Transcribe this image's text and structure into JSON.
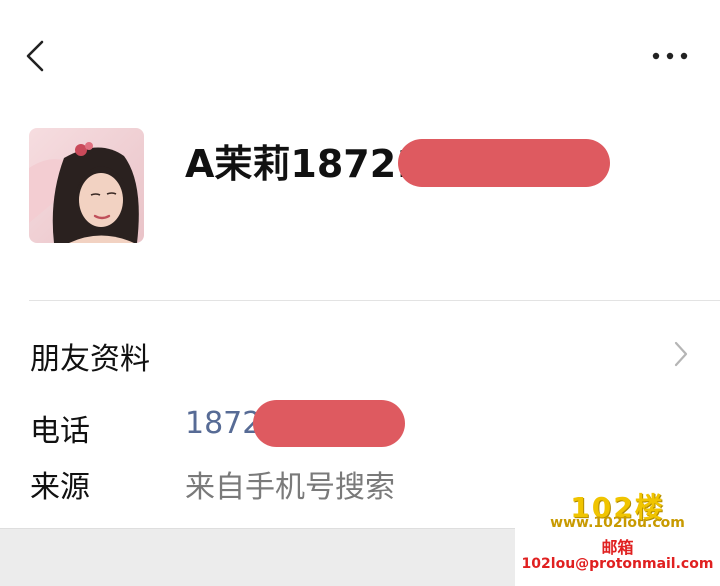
{
  "profile": {
    "nickname": "A茉莉18721"
  },
  "friend_info": {
    "label": "朋友资料"
  },
  "rows": {
    "phone_label": "电话",
    "phone_value": "1872",
    "source_label": "来源",
    "source_value": "来自手机号搜索"
  },
  "watermark": {
    "logo": "102楼",
    "site": "www.102lou.com",
    "mail_cn": "邮箱",
    "mail": "102lou@protonmail.com"
  },
  "colors": {
    "link": "#576b95",
    "redaction": "#de5a60",
    "secondary_text": "#7a7a7a"
  },
  "icons": {
    "back": "back-icon",
    "more": "more-icon",
    "chevron": "chevron-right-icon"
  }
}
